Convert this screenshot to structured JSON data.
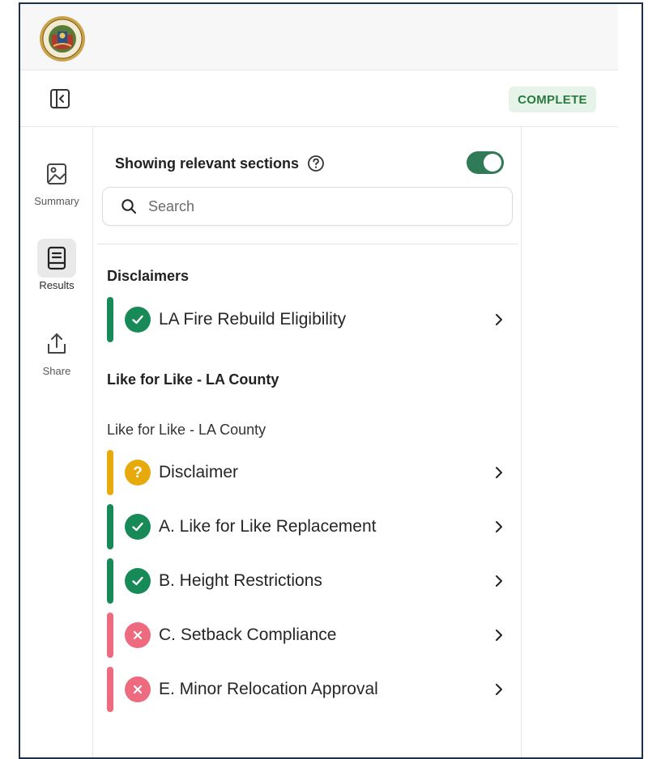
{
  "header": {
    "seal_icon": "county-seal-logo"
  },
  "toolbar": {
    "collapse_icon": "sidebar-collapse-icon",
    "status": "COMPLETE"
  },
  "rail": {
    "items": [
      {
        "label": "Summary",
        "icon": "image-icon",
        "active": false
      },
      {
        "label": "Results",
        "icon": "document-icon",
        "active": true
      },
      {
        "label": "Share",
        "icon": "share-icon",
        "active": false
      }
    ]
  },
  "panel": {
    "relevant_label": "Showing relevant sections",
    "relevant_on": true,
    "search_placeholder": "Search",
    "sections": [
      {
        "heading": "Disclaimers",
        "items": [
          {
            "label": "LA Fire Rebuild Eligibility",
            "status": "pass"
          }
        ]
      },
      {
        "heading": "Like for Like - LA County",
        "subheading": "Like for Like - LA County",
        "items": [
          {
            "label": "Disclaimer",
            "status": "unknown"
          },
          {
            "label": "A. Like for Like Replacement",
            "status": "pass"
          },
          {
            "label": "B. Height Restrictions",
            "status": "pass"
          },
          {
            "label": "C. Setback Compliance",
            "status": "fail"
          },
          {
            "label": "E. Minor Relocation Approval",
            "status": "fail"
          }
        ]
      }
    ]
  },
  "colors": {
    "pass": "#178a58",
    "unknown": "#e8a90c",
    "fail": "#ee6a7f",
    "toggle": "#2f7a57",
    "badge_bg": "#e6f3e9",
    "badge_text": "#2a7a3f"
  }
}
